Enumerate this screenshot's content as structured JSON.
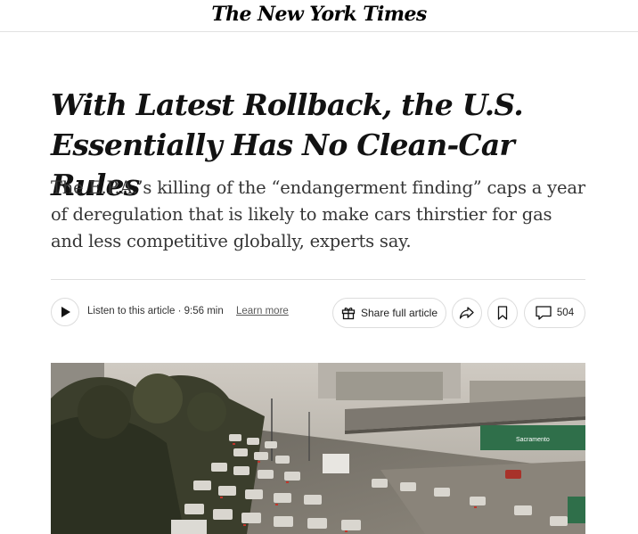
{
  "masthead": {
    "logo": "The New York Times"
  },
  "article": {
    "headline": "With Latest Rollback, the U.S. Essentially Has No Clean-Car Rules",
    "summary": "The E.P.A.’s killing of the “endangerment finding” caps a year of deregulation that is likely to make cars thirstier for gas and less competitive globally, experts say."
  },
  "toolbar": {
    "listen_label": "Listen to this article · 9:56 min",
    "learn_more": "Learn more",
    "share_full_label": "Share full article",
    "comment_count": "504"
  },
  "hero": {
    "sign_text": "Sacramento"
  },
  "icons": {
    "play": "play-icon",
    "gift": "gift-icon",
    "share": "share-arrow-icon",
    "bookmark": "bookmark-icon",
    "comment": "comment-icon"
  }
}
